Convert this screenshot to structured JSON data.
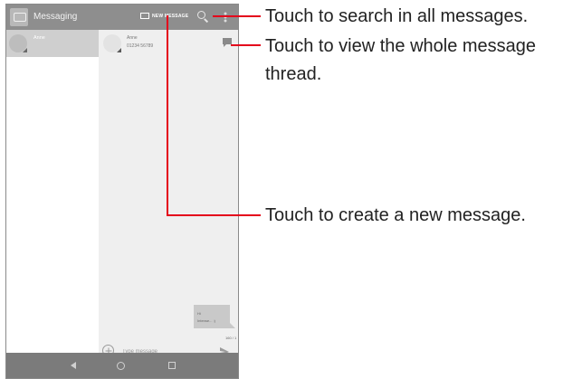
{
  "app": {
    "title": "Messaging",
    "new_message_label": "NEW MESSAGE"
  },
  "conversation_list": [
    {
      "name": "Anne"
    }
  ],
  "thread": {
    "contact_name": "Anne",
    "contact_number": "01234 56789",
    "bubble_line1": "Hi",
    "bubble_line2": "Intense... :)",
    "counter": "160 / 1",
    "input_placeholder": "Type message"
  },
  "callouts": {
    "search": "Touch to search in all messages.",
    "thread_line1": "Touch to view the whole message",
    "thread_line2": "thread.",
    "new_message": "Touch to create a new message."
  },
  "colors": {
    "accent": "#e4001b",
    "action_bar": "#8e8e8e",
    "nav_bar": "#7b7b7b"
  }
}
